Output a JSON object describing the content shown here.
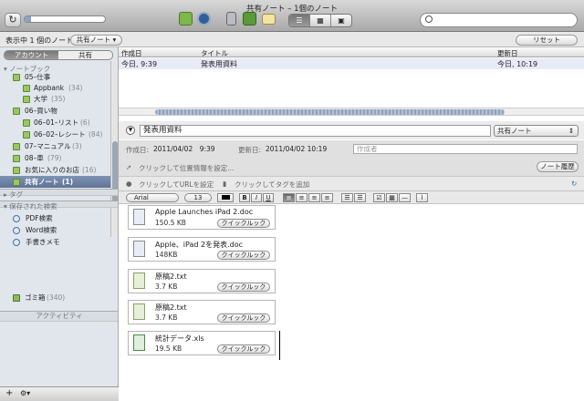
{
  "window": {
    "title": "共有ノート – 1個のノート"
  },
  "toolbar": {
    "sync_icon": "↻",
    "view_buttons": [
      "☰",
      "▦",
      "▣"
    ],
    "search_placeholder": "",
    "sync_progress_percent": 8
  },
  "filter": {
    "label": "表示中 1 個のノート",
    "scope": "共有ノート ▾",
    "reset": "リセット"
  },
  "sidebar": {
    "tabs": [
      "アカウント",
      "共有"
    ],
    "sections": {
      "notebooks": "▾ ノートブック",
      "tags": "▸ タグ",
      "saved": "▾ 保存された検索",
      "activity": "アクティビティ"
    },
    "notebooks": [
      {
        "label": "05–仕事",
        "count": ""
      },
      {
        "label": "Appbank",
        "count": "(34)"
      },
      {
        "label": "大学",
        "count": "(35)"
      },
      {
        "label": "06–買い物",
        "count": ""
      },
      {
        "label": "06–01–リスト",
        "count": "(6)"
      },
      {
        "label": "06–02–レシート",
        "count": "(84)"
      },
      {
        "label": "07–マニュアル",
        "count": "(3)"
      },
      {
        "label": "08–車",
        "count": "(79)"
      },
      {
        "label": "お気に入りのお店",
        "count": "(16)"
      },
      {
        "label": "共有ノート",
        "count": "(1)"
      }
    ],
    "searches": [
      "PDF検索",
      "Word検索",
      "手書きメモ"
    ],
    "trash": {
      "label": "ゴミ箱",
      "count": "(340)"
    },
    "bottom": {
      "add": "+",
      "gear": "⚙▾"
    }
  },
  "note_list": {
    "headers": {
      "created": "作成日",
      "title": "タイトル",
      "updated": "更新日"
    },
    "rows": [
      {
        "created": "今日, 9:39",
        "title": "発表用資料",
        "updated": "今日, 10:19"
      }
    ]
  },
  "editor": {
    "title": "発表用資料",
    "notebook": "共有ノート",
    "created_label": "作成日:",
    "created": "2011/04/02　9:39",
    "updated_label": "更新日:",
    "updated": "2011/04/02 10:19",
    "author_placeholder": "作成者",
    "location": "クリックして位置情報を設定...",
    "history": "ノート履歴",
    "url": "クリックしてURLを設定",
    "tags": "クリックしてタグを追加",
    "font": "Arial",
    "font_size": "13",
    "format": {
      "bold": "B",
      "italic": "I",
      "underline": "U"
    }
  },
  "attachments": [
    {
      "name": "Apple Launches iPad 2.doc",
      "size": "150.5 KB",
      "action": "クイックルック"
    },
    {
      "name": "Apple、iPad 2を発表.doc",
      "size": "148KB",
      "action": "クイックルック"
    },
    {
      "name": "原稿2.txt",
      "size": "3.7 KB",
      "action": "クイックルック"
    },
    {
      "name": "原稿2.txt",
      "size": "3.7 KB",
      "action": "クイックルック"
    },
    {
      "name": "統計データ.xls",
      "size": "19.5 KB",
      "action": "クイックルック"
    }
  ],
  "colors": {
    "accent": "#6478a0",
    "notebook_icon": "#9ac56a"
  }
}
